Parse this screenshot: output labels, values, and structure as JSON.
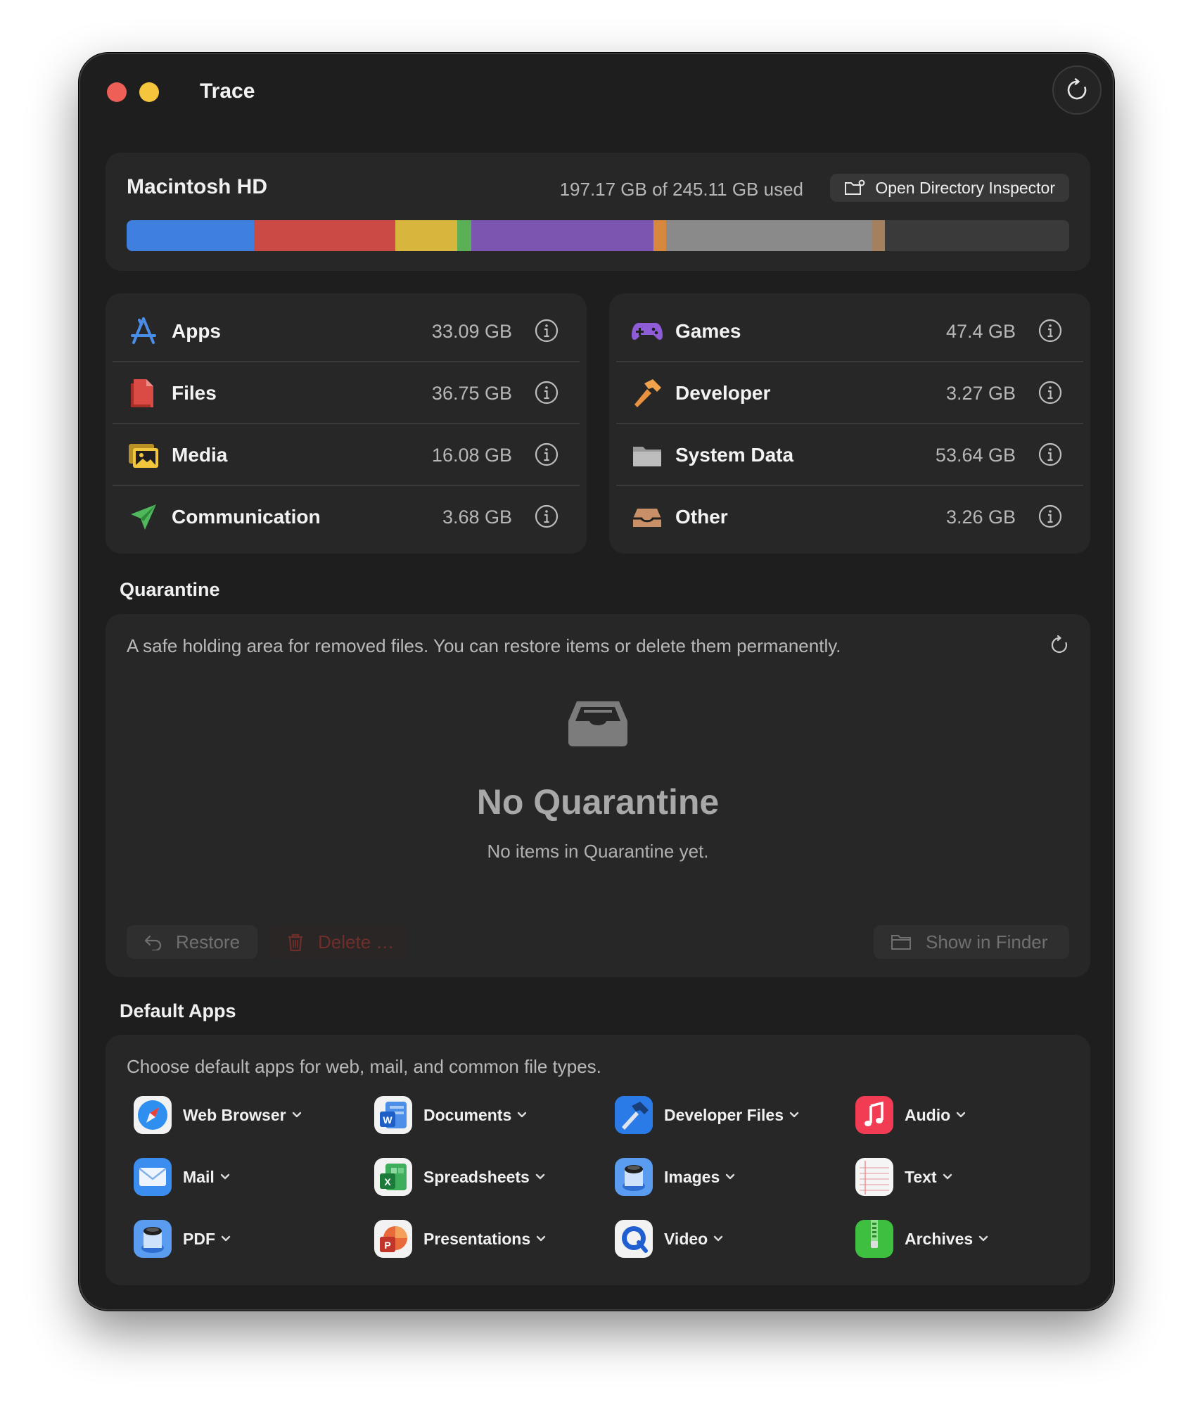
{
  "window": {
    "title": "Trace"
  },
  "disk": {
    "name": "Macintosh HD",
    "usage_text": "197.17 GB of 245.11 GB used",
    "inspector_label": "Open Directory Inspector",
    "segments": [
      {
        "name": "Apps",
        "value": 33.09,
        "color": "#3f80df"
      },
      {
        "name": "Files",
        "value": 36.75,
        "color": "#cc4a46"
      },
      {
        "name": "Media",
        "value": 16.08,
        "color": "#d8b53c"
      },
      {
        "name": "Communication",
        "value": 3.68,
        "color": "#5bb057"
      },
      {
        "name": "Games",
        "value": 47.4,
        "color": "#7c55b0"
      },
      {
        "name": "Developer",
        "value": 3.27,
        "color": "#d8883e"
      },
      {
        "name": "System Data",
        "value": 53.64,
        "color": "#8a8a8a"
      },
      {
        "name": "Other",
        "value": 3.26,
        "color": "#a4805e"
      }
    ],
    "total": 245.11
  },
  "categories_left": [
    {
      "label": "Apps",
      "size": "33.09 GB",
      "icon": "app-store-icon"
    },
    {
      "label": "Files",
      "size": "36.75 GB",
      "icon": "documents-icon"
    },
    {
      "label": "Media",
      "size": "16.08 GB",
      "icon": "photos-icon"
    },
    {
      "label": "Communication",
      "size": "3.68 GB",
      "icon": "paper-plane-icon"
    }
  ],
  "categories_right": [
    {
      "label": "Games",
      "size": "47.4 GB",
      "icon": "gamepad-icon"
    },
    {
      "label": "Developer",
      "size": "3.27 GB",
      "icon": "hammer-icon"
    },
    {
      "label": "System Data",
      "size": "53.64 GB",
      "icon": "folder-icon"
    },
    {
      "label": "Other",
      "size": "3.26 GB",
      "icon": "tray-icon"
    }
  ],
  "quarantine": {
    "section_title": "Quarantine",
    "description": "A safe holding area for removed files. You can restore items or delete them permanently.",
    "empty_title": "No Quarantine",
    "empty_subtitle": "No items in Quarantine yet.",
    "restore_label": "Restore",
    "delete_label": "Delete …",
    "finder_label": "Show in Finder"
  },
  "default_apps": {
    "section_title": "Default Apps",
    "description": "Choose default apps for web, mail, and common file types.",
    "items": [
      {
        "label": "Web Browser",
        "icon": "safari-icon"
      },
      {
        "label": "Documents",
        "icon": "word-icon"
      },
      {
        "label": "Developer Files",
        "icon": "xcode-icon"
      },
      {
        "label": "Audio",
        "icon": "music-icon"
      },
      {
        "label": "Mail",
        "icon": "mail-icon"
      },
      {
        "label": "Spreadsheets",
        "icon": "excel-icon"
      },
      {
        "label": "Images",
        "icon": "preview-icon"
      },
      {
        "label": "Text",
        "icon": "textedit-icon"
      },
      {
        "label": "PDF",
        "icon": "preview-icon"
      },
      {
        "label": "Presentations",
        "icon": "powerpoint-icon"
      },
      {
        "label": "Video",
        "icon": "quicktime-icon"
      },
      {
        "label": "Archives",
        "icon": "archive-utility-icon"
      }
    ]
  }
}
